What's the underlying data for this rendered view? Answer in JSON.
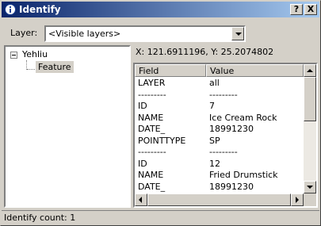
{
  "window": {
    "title": "Identify",
    "help_label": "?",
    "close_label": "X"
  },
  "layer": {
    "label": "Layer:",
    "selected": "<Visible layers>"
  },
  "tree": {
    "root": "Yehliu",
    "child": "Feature"
  },
  "coordinates": "X: 121.6911196, Y: 25.2074802",
  "grid": {
    "columns": [
      "Field",
      "Value"
    ],
    "rows": [
      {
        "field": "LAYER",
        "value": "all"
      },
      {
        "field": "---------",
        "value": "---------"
      },
      {
        "field": "ID",
        "value": "7"
      },
      {
        "field": "NAME",
        "value": "Ice Cream Rock"
      },
      {
        "field": "DATE_",
        "value": "18991230"
      },
      {
        "field": "POINTTYPE",
        "value": "SP"
      },
      {
        "field": "---------",
        "value": "---------"
      },
      {
        "field": "ID",
        "value": "12"
      },
      {
        "field": "NAME",
        "value": "Fried Drumstick"
      },
      {
        "field": "DATE_",
        "value": "18991230"
      }
    ]
  },
  "status": "Identify count: 1",
  "colors": {
    "titlebar_start": "#0a246a",
    "titlebar_end": "#a6caf0",
    "face": "#d4d0c8"
  },
  "icons": {
    "app": "identify-info-icon",
    "help": "help-icon",
    "close": "close-icon"
  }
}
